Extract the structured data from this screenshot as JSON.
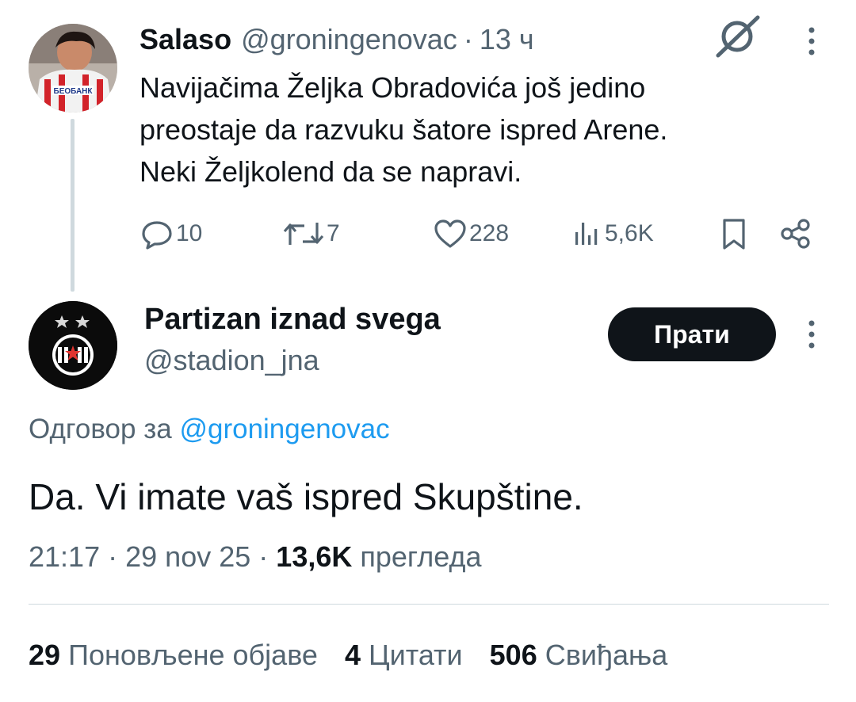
{
  "parent": {
    "author_name": "Salaso",
    "handle": "@groningenovac",
    "separator": "·",
    "time": "13 ч",
    "text_lines": [
      "Navijačima Željka Obradovića još jedino",
      "preostaje da razvuku šatore ispred Arene.",
      "Neki Željkolend da se napravi."
    ],
    "actions": {
      "replies": "10",
      "reposts": "7",
      "likes": "228",
      "views": "5,6K"
    },
    "avatar_jersey_text": "БЕОБАНК"
  },
  "main": {
    "author_name": "Partizan iznad svega",
    "handle": "@stadion_jna",
    "follow_label": "Прати",
    "reply_prefix": "Одговор за",
    "reply_handle": "@groningenovac",
    "text": "Da. Vi imate vaš ispred Skupštine.",
    "time": "21:17",
    "date": "29 nov 25",
    "separator": "·",
    "views_count": "13,6K",
    "views_label": "прегледа",
    "stats": {
      "reposts_count": "29",
      "reposts_label": "Поновљене објаве",
      "quotes_count": "4",
      "quotes_label": "Цитати",
      "likes_count": "506",
      "likes_label": "Свиђања"
    }
  },
  "colors": {
    "text": "#0f1419",
    "secondary": "#536471",
    "link": "#1d9bf0",
    "divider": "#cfd9de",
    "follow_bg": "#0f1419"
  }
}
